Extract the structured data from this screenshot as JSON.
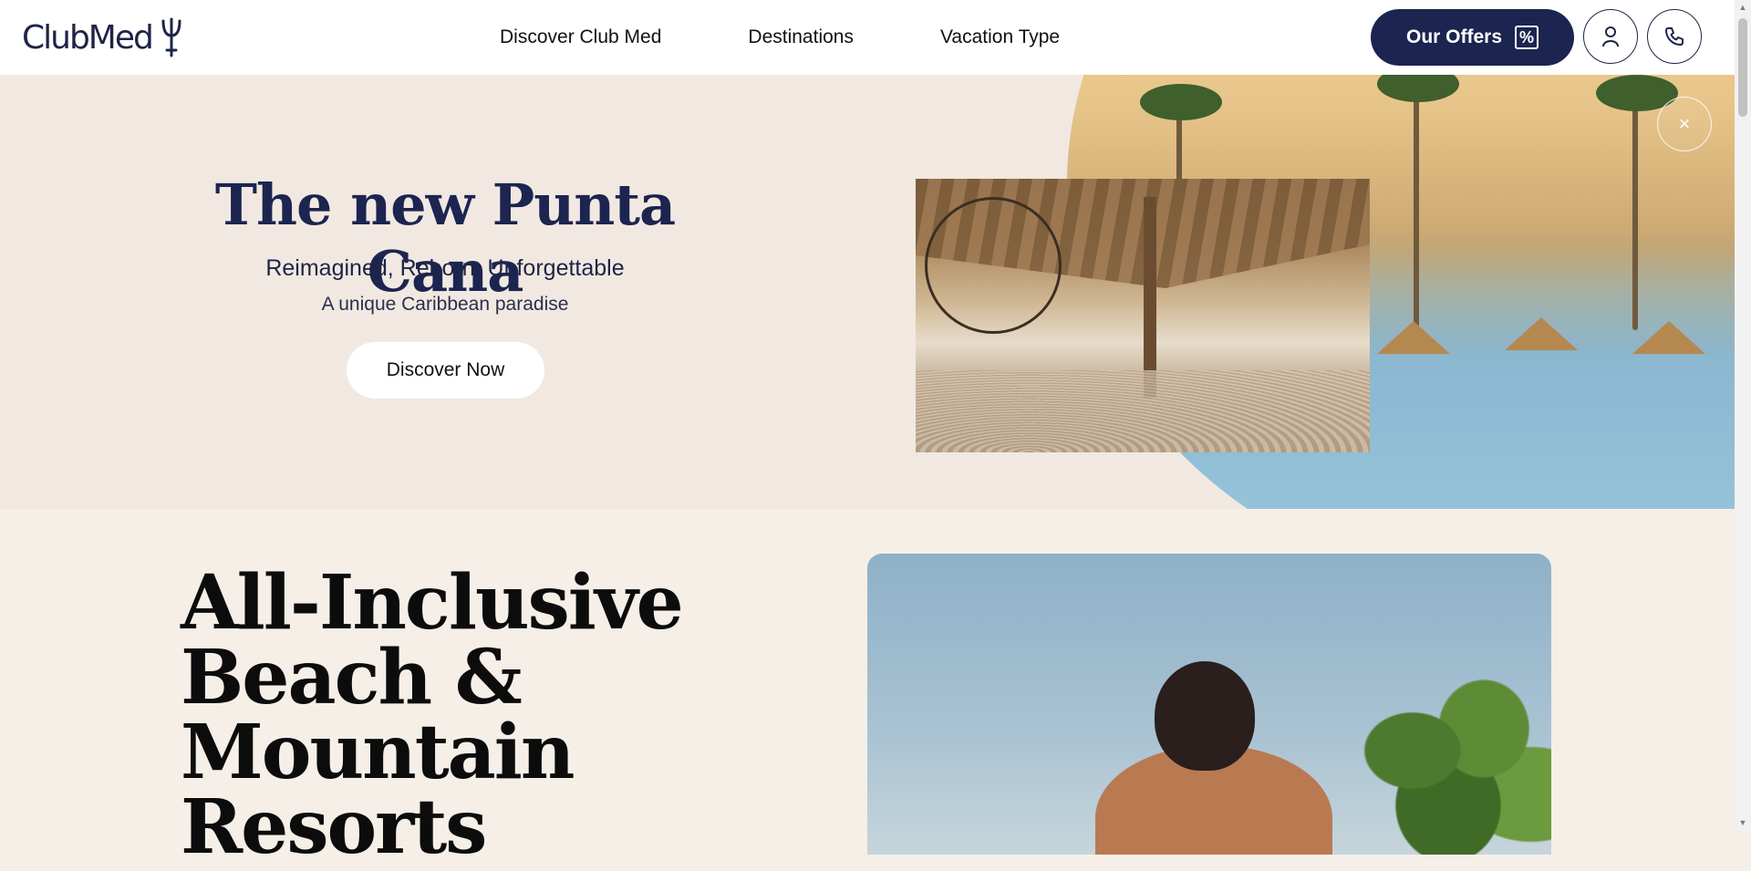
{
  "header": {
    "logo_text": "ClubMed",
    "nav": [
      {
        "label": "Discover Club Med"
      },
      {
        "label": "Destinations"
      },
      {
        "label": "Vacation Type"
      }
    ],
    "offers_label": "Our Offers",
    "offers_icon": "percent-icon",
    "account_icon": "user-icon",
    "phone_icon": "phone-icon"
  },
  "banner": {
    "title": "The new Punta Cana",
    "subtitle": "Reimagined, Reborn, Unforgettable",
    "tagline": "A unique Caribbean paradise",
    "cta_label": "Discover Now",
    "close_icon": "close-icon",
    "close_symbol": "×"
  },
  "section": {
    "title": "All-Inclusive Beach & Mountain Resorts"
  },
  "colors": {
    "brand_navy": "#1c2450",
    "banner_bg": "#f1e9e1",
    "page_bg": "#f5efe8"
  }
}
